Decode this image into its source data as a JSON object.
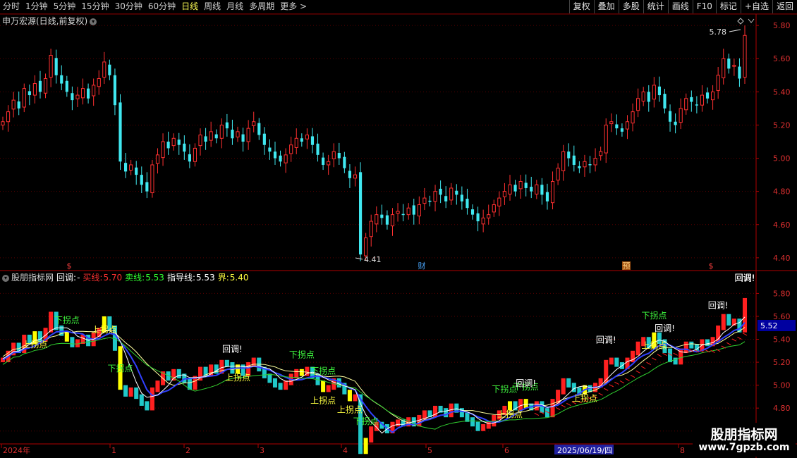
{
  "toolbar": {
    "periods": [
      "分时",
      "1分钟",
      "5分钟",
      "15分钟",
      "30分钟",
      "60分钟",
      "日线",
      "周线",
      "月线",
      "多周期",
      "更多 >"
    ],
    "active_period": "日线",
    "buttons": [
      "复权",
      "叠加",
      "多股",
      "统计",
      "画线",
      "F10",
      "标记",
      "+自选",
      "返回"
    ]
  },
  "main_pane": {
    "title": "申万宏源(日线,前复权)",
    "high_label": "5.78",
    "low_label": "4.41",
    "markers": [
      "$",
      "财",
      "预",
      "$"
    ]
  },
  "indicator_pane": {
    "title": "股朋指标网",
    "items": [
      {
        "label": "回调:",
        "value": "-",
        "color": "#ffffff"
      },
      {
        "label": "买线:",
        "value": "5.70",
        "color": "#ff3030"
      },
      {
        "label": "卖线:",
        "value": "5.53",
        "color": "#30ff30"
      },
      {
        "label": "指导线:",
        "value": "5.53",
        "color": "#ffffff"
      },
      {
        "label": "界:",
        "value": "5.40",
        "color": "#ffff40"
      }
    ],
    "current_price": "5.52"
  },
  "watermark": {
    "title": "股朋指标网",
    "url": "www.7gpzb.com"
  },
  "chart_data": [
    {
      "type": "candlestick",
      "title": "申万宏源(日线,前复权)",
      "y_ticks": [
        4.4,
        4.6,
        4.8,
        5.0,
        5.2,
        5.4,
        5.6,
        5.8
      ],
      "y_tick_labels": [
        "4.40",
        "4.60",
        "4.80",
        "5.00",
        "5.20",
        "5.40",
        "5.60",
        "5.80"
      ],
      "ylim": [
        4.34,
        5.86
      ],
      "grid": true,
      "colors": {
        "up": "#ff3030",
        "down": "#40e8f0"
      },
      "close": [
        5.22,
        5.28,
        5.35,
        5.3,
        5.42,
        5.38,
        5.45,
        5.4,
        5.48,
        5.62,
        5.5,
        5.45,
        5.4,
        5.35,
        5.38,
        5.42,
        5.36,
        5.44,
        5.48,
        5.58,
        5.5,
        5.32,
        4.98,
        4.92,
        4.96,
        4.9,
        4.84,
        4.8,
        4.96,
        5.02,
        5.1,
        5.06,
        5.12,
        5.08,
        5.04,
        4.98,
        5.06,
        5.14,
        5.1,
        5.16,
        5.12,
        5.2,
        5.18,
        5.12,
        5.16,
        5.1,
        5.18,
        5.22,
        5.14,
        5.08,
        5.04,
        5.0,
        4.98,
        5.02,
        5.08,
        5.12,
        5.1,
        5.14,
        5.08,
        5.02,
        4.96,
        4.98,
        5.04,
        5.0,
        4.94,
        4.88,
        4.9,
        4.42,
        4.52,
        4.62,
        4.66,
        4.64,
        4.6,
        4.66,
        4.68,
        4.66,
        4.7,
        4.66,
        4.72,
        4.76,
        4.74,
        4.8,
        4.78,
        4.74,
        4.82,
        4.78,
        4.74,
        4.7,
        4.66,
        4.62,
        4.64,
        4.66,
        4.72,
        4.76,
        4.8,
        4.84,
        4.8,
        4.86,
        4.82,
        4.8,
        4.84,
        4.78,
        4.74,
        4.86,
        4.94,
        5.04,
        5.0,
        4.96,
        4.94,
        4.98,
        4.96,
        5.0,
        5.04,
        5.2,
        5.22,
        5.18,
        5.16,
        5.22,
        5.28,
        5.36,
        5.4,
        5.34,
        5.44,
        5.38,
        5.3,
        5.22,
        5.2,
        5.3,
        5.36,
        5.34,
        5.32,
        5.38,
        5.36,
        5.4,
        5.5,
        5.6,
        5.54,
        5.56,
        5.48,
        5.74
      ],
      "high": 5.78,
      "low": 4.41,
      "markers": [
        "$",
        "财",
        "预",
        "$"
      ]
    },
    {
      "type": "indicator",
      "title": "股朋指标网",
      "y_ticks": [
        4.6,
        4.8,
        5.0,
        5.2,
        5.4,
        5.6,
        5.8
      ],
      "y_tick_labels": [
        "4.60",
        "4.80",
        "5.00",
        "5.20",
        "5.40",
        "5.60",
        "5.80"
      ],
      "ylim": [
        4.5,
        5.95
      ],
      "current_value": 5.52,
      "series": [
        {
          "name": "买线",
          "value": "5.70",
          "color": "#ff3030"
        },
        {
          "name": "卖线",
          "value": "5.53",
          "color": "#30ff30"
        },
        {
          "name": "指导线",
          "value": "5.53",
          "color": "#ffffff"
        },
        {
          "name": "界",
          "value": "5.40",
          "color": "#ffff40"
        }
      ],
      "bar_colors": {
        "up": "#ff2020",
        "down": "#20c8c8",
        "signal": "#ffff00"
      },
      "annotations": [
        {
          "text": "上拐点",
          "color": "#ffff40",
          "index": 6
        },
        {
          "text": "下拐点",
          "color": "#40ff40",
          "index": 12
        },
        {
          "text": "上拐点",
          "color": "#ffff40",
          "index": 19
        },
        {
          "text": "下拐点",
          "color": "#40ff40",
          "index": 22
        },
        {
          "text": "回调!",
          "color": "#ffffff",
          "index": 43
        },
        {
          "text": "上拐点",
          "color": "#ffff40",
          "index": 44
        },
        {
          "text": "下拐点",
          "color": "#40ff40",
          "index": 56
        },
        {
          "text": "下拐点",
          "color": "#40ff40",
          "index": 60
        },
        {
          "text": "上拐点",
          "color": "#ffff40",
          "index": 60
        },
        {
          "text": "上拐点",
          "color": "#ffff40",
          "index": 65
        },
        {
          "text": "下拐点",
          "color": "#40ff40",
          "index": 68
        },
        {
          "text": "下拐点",
          "color": "#40ff40",
          "index": 94
        },
        {
          "text": "下拐点",
          "color": "#40ff40",
          "index": 98
        },
        {
          "text": "上拐点",
          "color": "#ffff40",
          "index": 95
        },
        {
          "text": "回调!",
          "color": "#ffffff",
          "index": 98
        },
        {
          "text": "上拐点",
          "color": "#ffff40",
          "index": 109
        },
        {
          "text": "回调!",
          "color": "#ffffff",
          "index": 113
        },
        {
          "text": "下拐点",
          "color": "#40ff40",
          "index": 122
        },
        {
          "text": "上拐点",
          "color": "#ffff40",
          "index": 122
        },
        {
          "text": "回调!",
          "color": "#ffffff",
          "index": 124
        },
        {
          "text": "回调!",
          "color": "#ffffff",
          "index": 134
        },
        {
          "text": "回调!",
          "color": "#ffffff",
          "index": 140
        },
        {
          "text": "回调!",
          "color": "#ffffff",
          "index": 143
        },
        {
          "text": "回调!",
          "color": "#ffffff",
          "index": 155
        },
        {
          "text": "回调!",
          "color": "#ffffff",
          "index": 160
        }
      ]
    },
    {
      "type": "date_axis",
      "labels": [
        "2024年",
        "1",
        "2",
        "3",
        "4",
        "5",
        "6",
        "2025/06/19/四",
        "8"
      ]
    }
  ]
}
